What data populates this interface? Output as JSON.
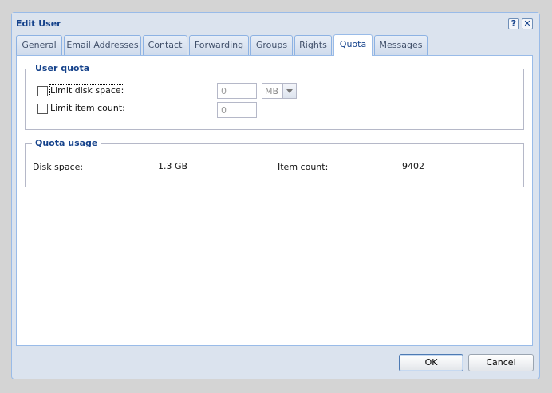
{
  "window": {
    "title": "Edit User",
    "help_icon": "?",
    "close_icon": "✕"
  },
  "tabs": [
    {
      "label": "General"
    },
    {
      "label": "Email Addresses"
    },
    {
      "label": "Contact"
    },
    {
      "label": "Forwarding"
    },
    {
      "label": "Groups"
    },
    {
      "label": "Rights"
    },
    {
      "label": "Quota",
      "active": true
    },
    {
      "label": "Messages"
    }
  ],
  "user_quota": {
    "legend": "User quota",
    "limit_disk": {
      "label": "Limit disk space:",
      "checked": false,
      "value": "0",
      "unit": "MB"
    },
    "limit_items": {
      "label": "Limit item count:",
      "checked": false,
      "value": "0"
    }
  },
  "quota_usage": {
    "legend": "Quota usage",
    "disk_label": "Disk space:",
    "disk_value": "1.3 GB",
    "items_label": "Item count:",
    "items_value": "9402"
  },
  "buttons": {
    "ok": "OK",
    "cancel": "Cancel"
  },
  "colors": {
    "accent": "#15428b",
    "frame": "#dbe3ee",
    "border": "#99bbe8"
  }
}
